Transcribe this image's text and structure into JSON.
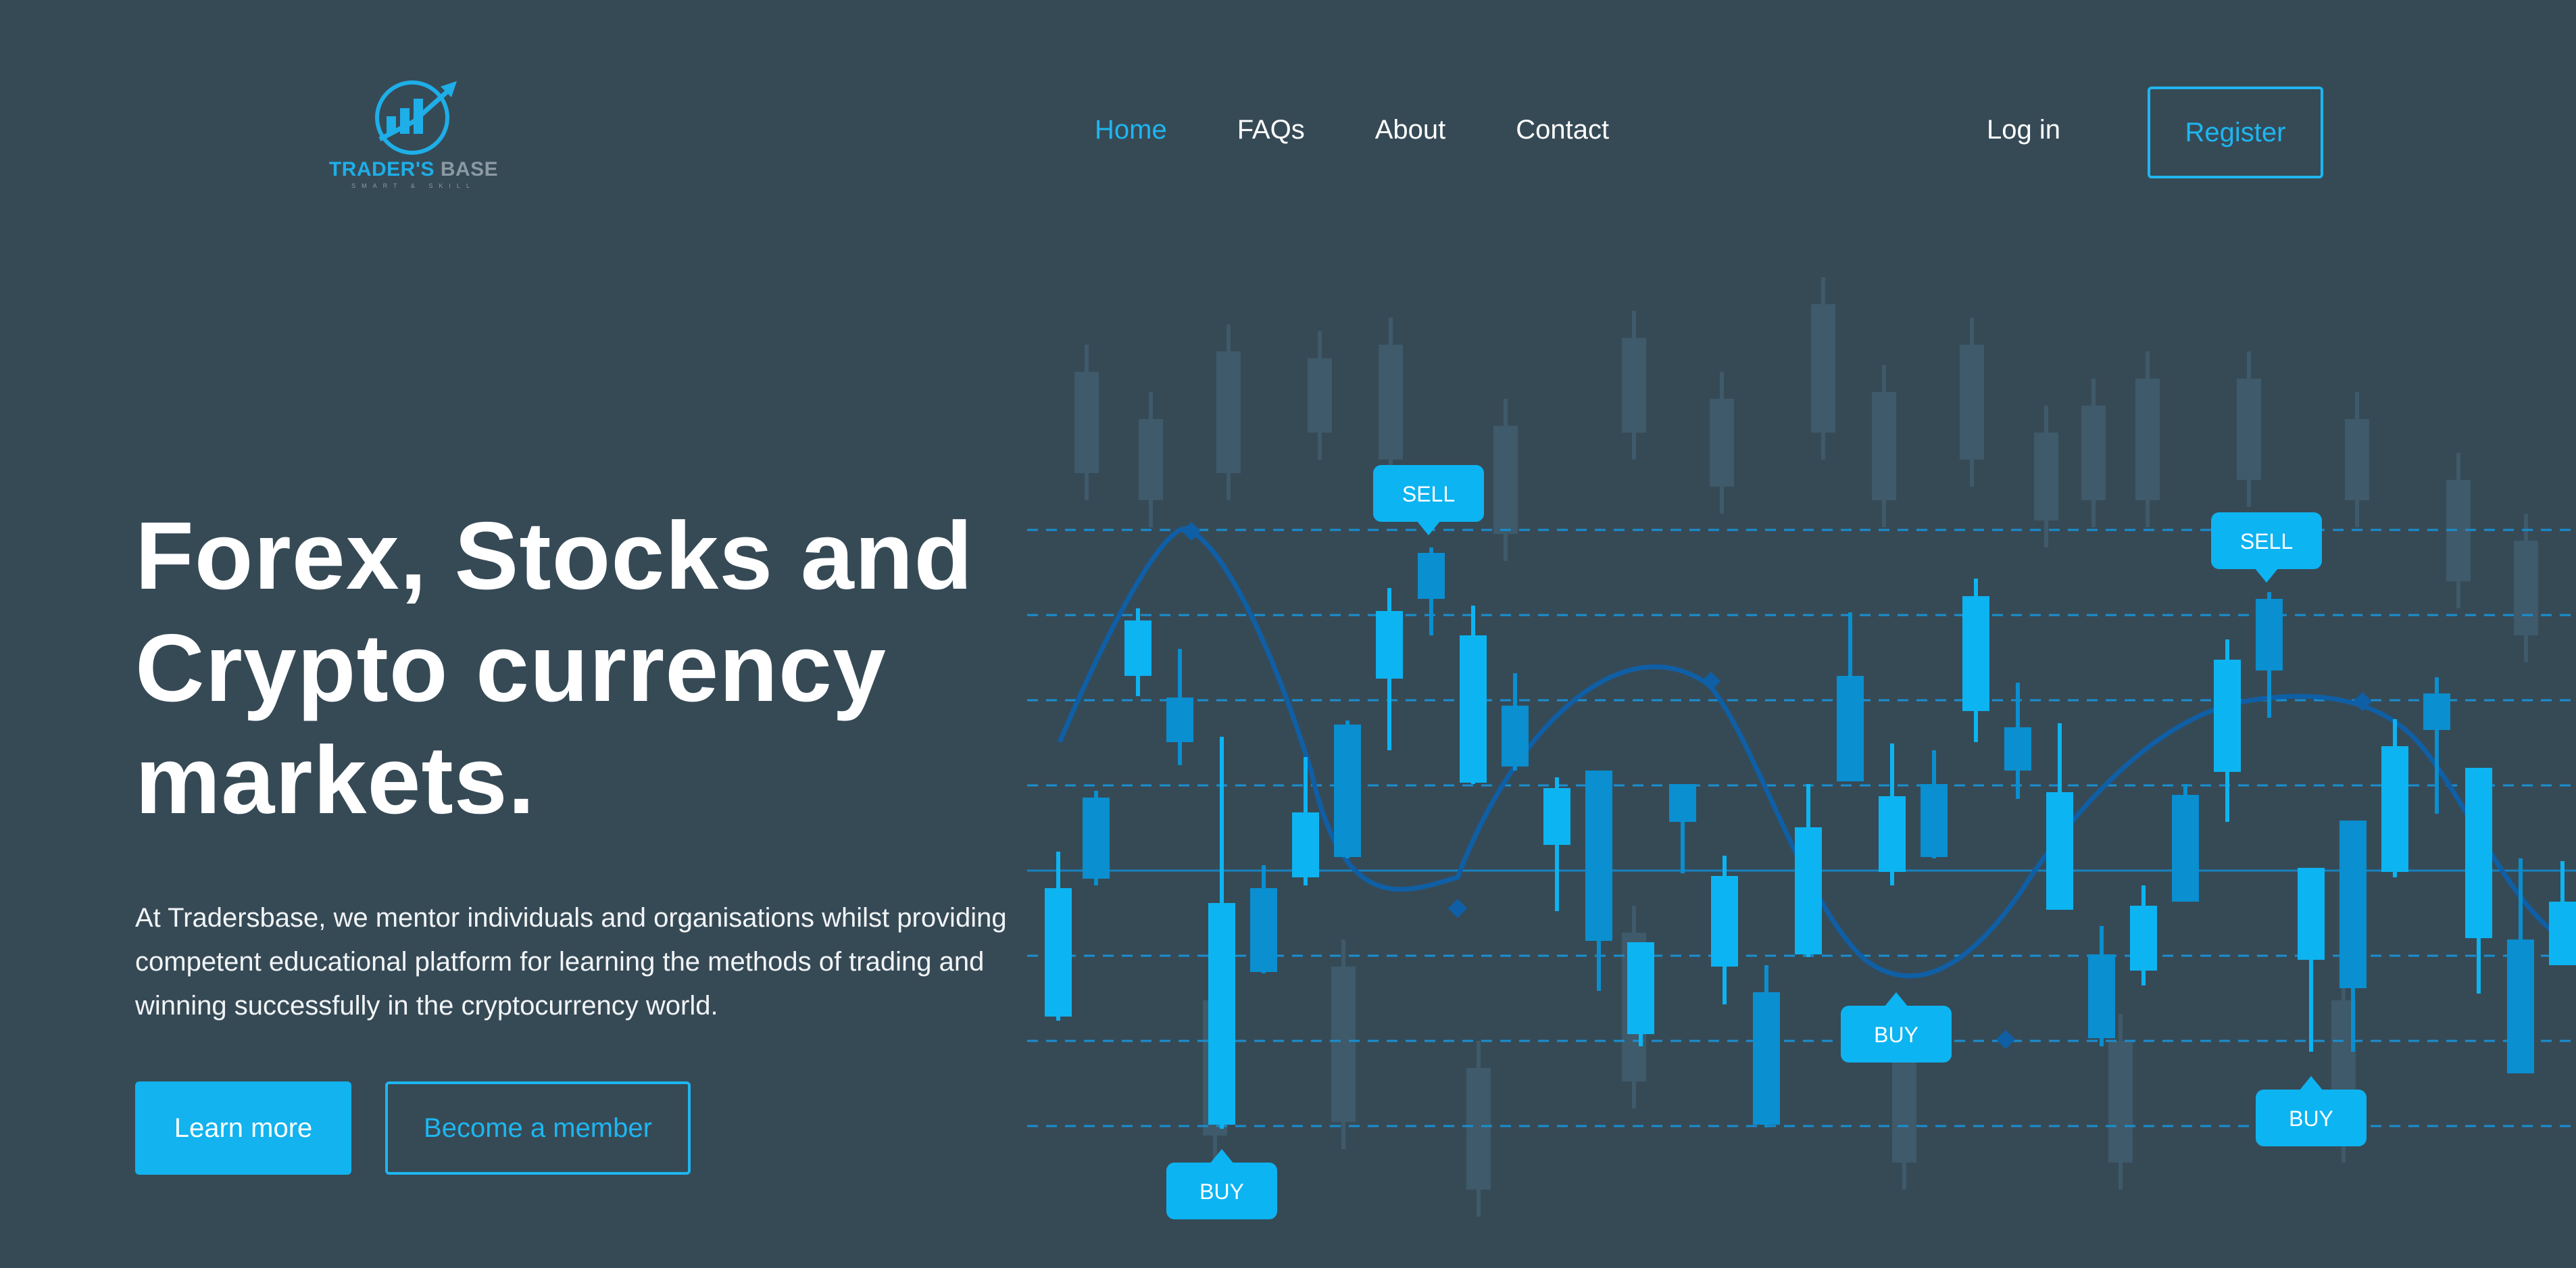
{
  "header": {
    "logo": {
      "name": "TRADER'S",
      "name_accent": "BASE",
      "tagline": "SMART & SKILL"
    },
    "nav": [
      {
        "label": "Home",
        "active": true
      },
      {
        "label": "FAQs",
        "active": false
      },
      {
        "label": "About",
        "active": false
      },
      {
        "label": "Contact",
        "active": false
      }
    ],
    "login_label": "Log in",
    "register_label": "Register"
  },
  "hero": {
    "title_line1": "Forex, Stocks and",
    "title_line2": "Crypto currency",
    "title_line3": "markets.",
    "description": "At Tradersbase, we mentor individuals and organisations whilst providing competent educational platform for learning the methods of trading and winning successfully in the cryptocurrency world.",
    "learn_more_label": "Learn more",
    "member_label": "Become a member"
  },
  "illustration": {
    "signals": [
      {
        "label": "SELL"
      },
      {
        "label": "SELL"
      },
      {
        "label": "BUY"
      },
      {
        "label": "BUY"
      },
      {
        "label": "BUY"
      }
    ]
  },
  "colors": {
    "background": "#364a56",
    "accent": "#1eb6f0",
    "candle_light": "#0db4f2",
    "candle_dark": "#0a8fd0",
    "wave": "#0f5fa6"
  }
}
